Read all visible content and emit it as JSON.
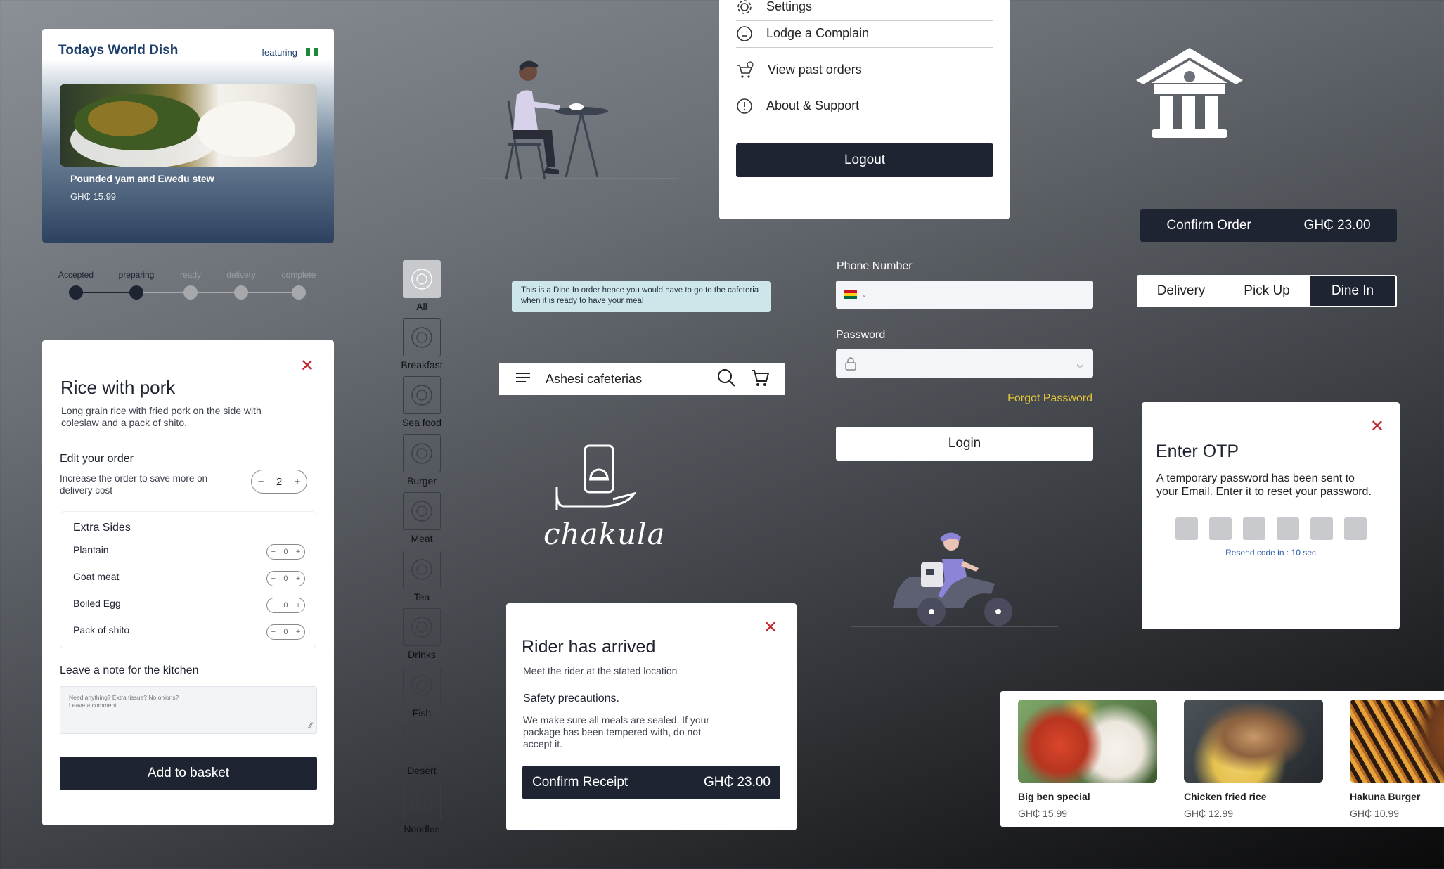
{
  "world_dish": {
    "title": "Todays World Dish",
    "featuring": "featuring",
    "dish_name": "Pounded yam and Ewedu stew",
    "dish_price": "GH₵  15.99"
  },
  "progress": {
    "steps": [
      "Accepted",
      "preparing",
      "ready",
      "delivery",
      "complete"
    ],
    "completed_count": 2
  },
  "rice_card": {
    "close": "✕",
    "title": "Rice with pork",
    "description": "Long grain rice with fried pork on the side with coleslaw and a pack of shito.",
    "edit_heading": "Edit your order",
    "edit_hint": "Increase the order to save more on delivery cost",
    "quantity": "2",
    "extra_sides_heading": "Extra Sides",
    "sides": [
      {
        "label": "Plantain",
        "qty": "0"
      },
      {
        "label": "Goat meat",
        "qty": "0"
      },
      {
        "label": "Boiled Egg",
        "qty": "0"
      },
      {
        "label": "Pack of shito",
        "qty": "0"
      }
    ],
    "note_heading": "Leave a note for the kitchen",
    "note_placeholder_1": "Need anything? Extra tissue? No onions?",
    "note_placeholder_2": "Leave a comment",
    "add_button": "Add to basket"
  },
  "categories": [
    "All",
    "Breakfast",
    "Sea food",
    "Burger",
    "Meat",
    "Tea",
    "Drinks",
    "Fish",
    "Desert",
    "Noodles"
  ],
  "info_banner": "This is a Dine In order hence you would have to go to the cafeteria when it is ready to have your meal",
  "appbar": {
    "title": "Ashesi cafeterias"
  },
  "logo": {
    "word": "chakula"
  },
  "rider_card": {
    "close": "✕",
    "title": "Rider has arrived",
    "subtitle": "Meet the rider at the stated location",
    "safety_heading": "Safety precautions.",
    "safety_body": "We make sure all meals are sealed. If your package has been tempered with, do not accept it.",
    "confirm_label": "Confirm Receipt",
    "confirm_amount": "GH₵   23.00"
  },
  "settings_menu": {
    "items": [
      "Settings",
      "Lodge a  Complain",
      "View past orders",
      "About & Support"
    ],
    "logout": "Logout"
  },
  "login": {
    "phone_label": "Phone Number",
    "password_label": "Password",
    "forgot": "Forgot Password",
    "login_button": "Login"
  },
  "confirm_order": {
    "label": "Confirm Order",
    "amount": "GH₵  23.00"
  },
  "order_mode": {
    "options": [
      "Delivery",
      "Pick Up",
      "Dine In"
    ],
    "selected": "Dine In"
  },
  "otp": {
    "close": "✕",
    "title": "Enter OTP",
    "body": "A temporary password has been sent to your Email. Enter it to reset your password.",
    "resend": "Resend code in : 10 sec"
  },
  "foods": [
    {
      "name": "Big ben special",
      "price": "GH₵  15.99"
    },
    {
      "name": "Chicken fried rice",
      "price": "GH₵  12.99"
    },
    {
      "name": "Hakuna Burger",
      "price": "GH₵  10.99"
    }
  ],
  "colors": {
    "navy": "#1f2433",
    "accent_red": "#c0272d",
    "link_yellow": "#e5c53a",
    "progress_active": "#1f2433",
    "progress_inactive": "#a7a8ab"
  }
}
